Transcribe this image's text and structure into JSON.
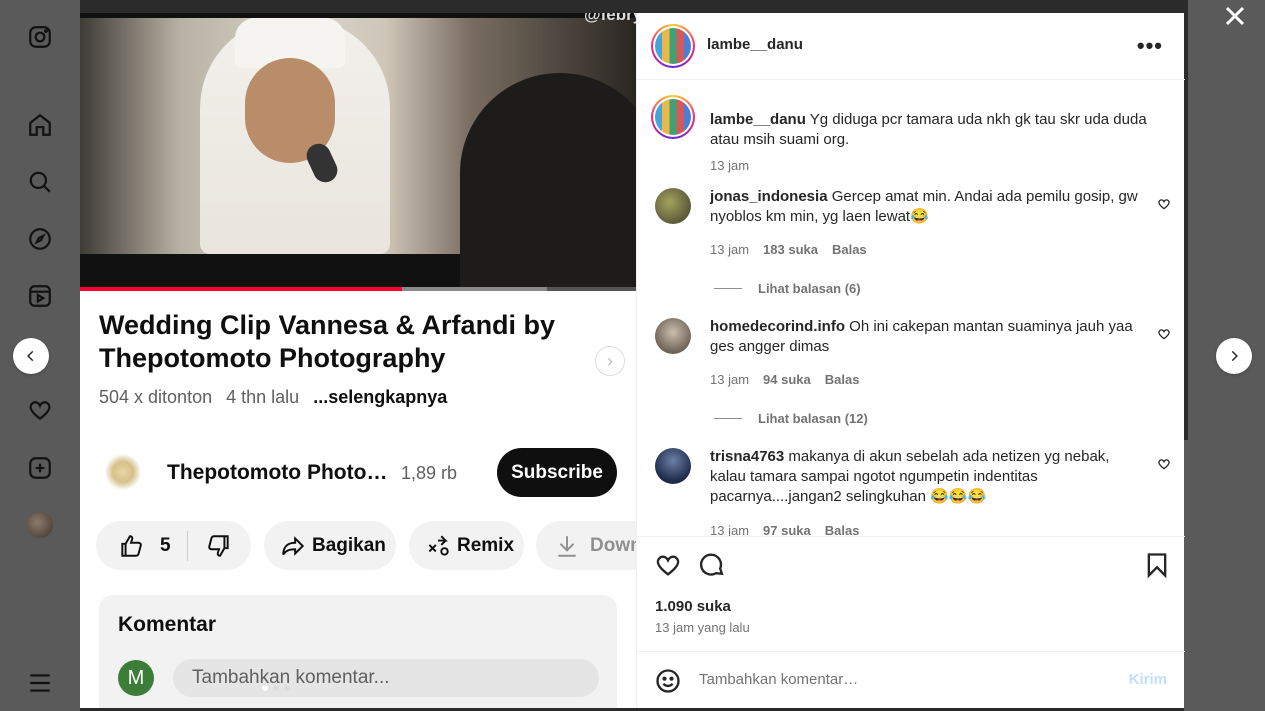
{
  "video": {
    "watermark": "@febrynameheda",
    "title": "Wedding Clip Vannesa & Arfandi by Thepotomoto Photography",
    "views": "504 x ditonton",
    "age": "4 thn lalu",
    "more": "...selengkapnya",
    "progress_percent": 58,
    "buffered_percent": 84,
    "channel": "Thepotomoto Photog...",
    "subscribers": "1,89 rb",
    "subscribe_label": "Subscribe",
    "likes": "5",
    "share_label": "Bagikan",
    "remix_label": "Remix",
    "download_label": "Down",
    "comments_title": "Komentar",
    "comment_avatar_letter": "M",
    "comment_placeholder": "Tambahkan komentar..."
  },
  "post": {
    "username": "lambe__danu",
    "caption_user": "lambe__danu",
    "caption_text": "Yg diduga pcr tamara uda nkh gk tau skr uda duda atau msih suami org.",
    "caption_time": "13 jam",
    "comments": [
      {
        "user": "jonas_indonesia",
        "text": "Gercep amat min. Andai ada pemilu gosip, gw nyoblos km min, yg laen lewat😂",
        "time": "13 jam",
        "likes": "183 suka",
        "reply": "Balas",
        "replies": "Lihat balasan (6)"
      },
      {
        "user": "homedecorind.info",
        "text": "Oh ini cakepan mantan suaminya jauh yaa ges angger dimas",
        "time": "13 jam",
        "likes": "94 suka",
        "reply": "Balas",
        "replies": "Lihat balasan (12)"
      },
      {
        "user": "trisna4763",
        "text": "makanya di akun sebelah ada netizen yg nebak, kalau tamara sampai ngotot ngumpetin indentitas pacarnya....jangan2 selingkuhan 😂😂😂",
        "time": "13 jam",
        "likes": "97 suka",
        "reply": "Balas"
      }
    ],
    "like_count": "1.090 suka",
    "posted_ago": "13 jam yang lalu",
    "add_comment_placeholder": "Tambahkan komentar…",
    "send_label": "Kirim"
  },
  "colors": {
    "send_disabled": "#c0dffd",
    "youtube_red": "#ff0033"
  },
  "icons": [
    "instagram-icon",
    "home-icon",
    "search-icon",
    "explore-icon",
    "reels-icon",
    "heart-icon",
    "create-icon",
    "menu-icon",
    "close-icon",
    "chevron-left-icon",
    "chevron-right-icon",
    "bookmark-icon",
    "comment-icon",
    "emoji-icon"
  ]
}
